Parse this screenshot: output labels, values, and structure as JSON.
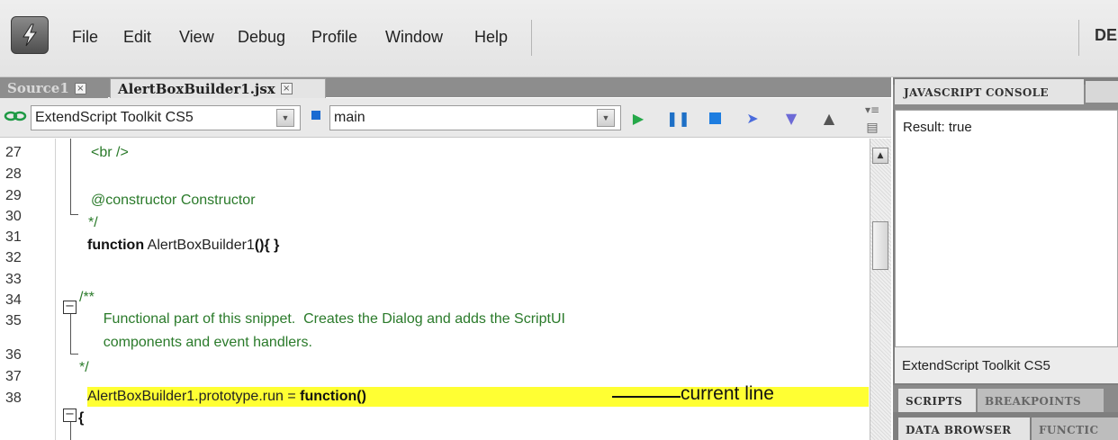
{
  "menubar": {
    "items": [
      "File",
      "Edit",
      "View",
      "Debug",
      "Profile",
      "Window",
      "Help"
    ],
    "right_text": "DE"
  },
  "tabs": [
    {
      "label": "Source1",
      "close": "×",
      "active": false
    },
    {
      "label": "AlertBoxBuilder1.jsx",
      "close": "×",
      "active": true
    }
  ],
  "toolbar": {
    "target_app": "ExtendScript Toolkit CS5",
    "engine": "main",
    "buttons": [
      "run",
      "pause",
      "stop",
      "step-over",
      "step-into",
      "step-out"
    ]
  },
  "editor": {
    "line_numbers": [
      "27",
      "28",
      "29",
      "30",
      "31",
      "32",
      "33",
      "34",
      "35",
      "36",
      "37",
      "38"
    ],
    "lines": {
      "l27": "<br />",
      "l29": "@constructor Constructor",
      "l30": "*/",
      "l31_kw": "function",
      "l31_rest": " AlertBoxBuilder1",
      "l31_tail": "(){ }",
      "l33": "/**",
      "l34": "    Functional part of this snippet.  Creates the Dialog and adds the ScriptUI",
      "l35": "    components and event handlers.",
      "l36": "*/",
      "l37_pre": "AlertBoxBuilder1.prototype.run = ",
      "l37_kw": "function()",
      "l38": "{"
    },
    "fold_symbol": "−",
    "current_line": "37",
    "annotation": "current line"
  },
  "console": {
    "tab_label": "JAVASCRIPT CONSOLE",
    "result": "Result: true",
    "target": "ExtendScript Toolkit CS5"
  },
  "bottom_tabs": {
    "scripts": "SCRIPTS",
    "breakpoints": "BREAKPOINTS",
    "data_browser": "DATA BROWSER",
    "functions": "FUNCTIC"
  },
  "colors": {
    "current_line": "#ffff33",
    "comment": "#2a7a2a"
  }
}
